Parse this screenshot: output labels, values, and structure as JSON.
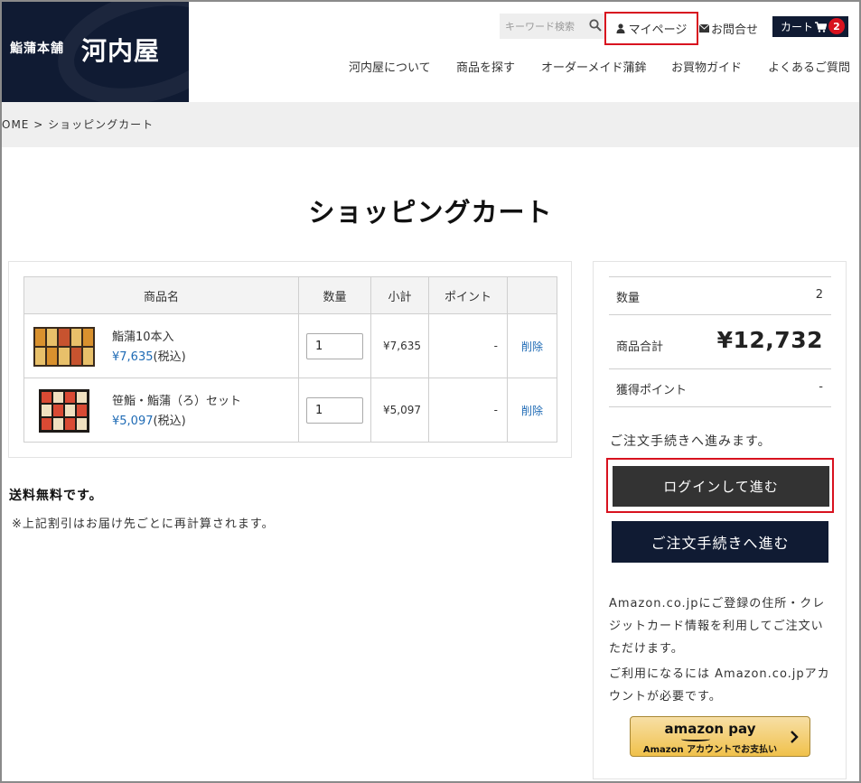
{
  "header": {
    "logo_small": "鮨蒲本舗",
    "logo_big": "河内屋",
    "search_placeholder": "キーワード検索",
    "mypage": "マイページ",
    "contact": "お問合せ",
    "cart_label": "カート",
    "cart_count": "2",
    "nav": [
      "河内屋について",
      "商品を探す",
      "オーダーメイド蒲鉾",
      "お買物ガイド",
      "よくあるご質問"
    ]
  },
  "breadcrumb": "OME > ショッピングカート",
  "page_title": "ショッピングカート",
  "table": {
    "headers": [
      "商品名",
      "数量",
      "小計",
      "ポイント",
      ""
    ],
    "rows": [
      {
        "name": "鮨蒲10本入",
        "price": "¥7,635",
        "tax": "(税込)",
        "qty": "1",
        "subtotal": "¥7,635",
        "points": "-",
        "delete": "削除"
      },
      {
        "name": "笹鮨・鮨蒲（ろ）セット",
        "price": "¥5,097",
        "tax": "(税込)",
        "qty": "1",
        "subtotal": "¥5,097",
        "points": "-",
        "delete": "削除"
      }
    ]
  },
  "shipping_note": "送料無料です。",
  "recalc_note": "※上記割引はお届け先ごとに再計算されます。",
  "summary": {
    "qty_label": "数量",
    "qty_value": "2",
    "total_label": "商品合計",
    "total_value": "¥12,732",
    "points_label": "獲得ポイント",
    "points_value": "-",
    "proceed_text": "ご注文手続きへ進みます。",
    "login_button": "ログインして進む",
    "order_button": "ご注文手続きへ進む",
    "amazon_text_1": "Amazon.co.jpにご登録の住所・クレジットカード情報を利用してご注文いただけます。",
    "amazon_text_2": "ご利用になるには Amazon.co.jpアカウントが必要です。",
    "amazon_pay_logo": "amazon pay",
    "amazon_pay_sub": "Amazon アカウントでお支払い"
  },
  "colors": {
    "navy": "#101b33",
    "red_highlight": "#d8121f",
    "link_blue": "#1f6bb5"
  }
}
